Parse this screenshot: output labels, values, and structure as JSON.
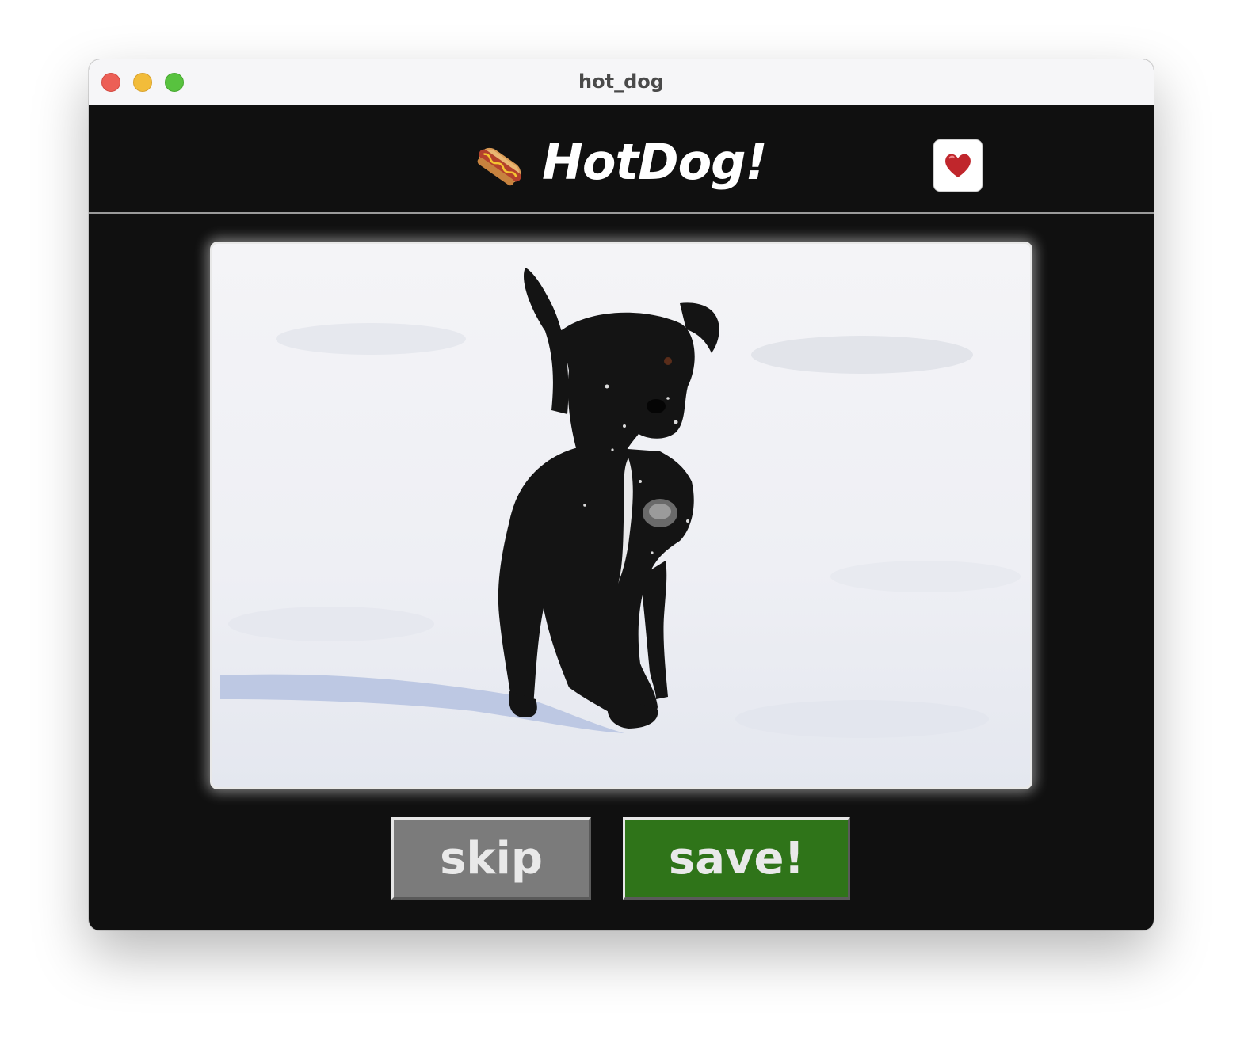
{
  "window": {
    "title": "hot_dog"
  },
  "header": {
    "app_title": "HotDog!",
    "logo_icon": "hotdog-icon",
    "favorite_icon": "heart-icon"
  },
  "photo": {
    "subject": "dog-photo"
  },
  "actions": {
    "skip_label": "skip",
    "save_label": "save!"
  },
  "colors": {
    "background": "#101010",
    "skip_button": "#7b7b7b",
    "save_button": "#2f7419",
    "heart": "#c0262c"
  }
}
